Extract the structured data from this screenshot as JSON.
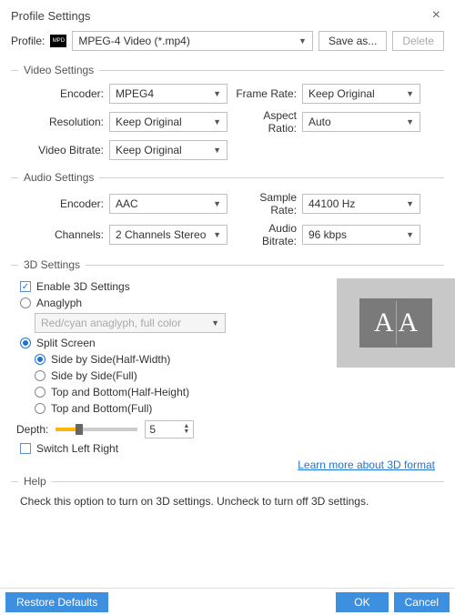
{
  "title": "Profile Settings",
  "close_label": "×",
  "profile_row": {
    "label": "Profile:",
    "icon": "MPD",
    "value": "MPEG-4 Video (*.mp4)",
    "save_as": "Save as...",
    "delete": "Delete"
  },
  "video": {
    "section": "Video Settings",
    "encoder_label": "Encoder:",
    "encoder": "MPEG4",
    "resolution_label": "Resolution:",
    "resolution": "Keep Original",
    "bitrate_label": "Video Bitrate:",
    "bitrate": "Keep Original",
    "frame_rate_label": "Frame Rate:",
    "frame_rate": "Keep Original",
    "aspect_label": "Aspect Ratio:",
    "aspect": "Auto"
  },
  "audio": {
    "section": "Audio Settings",
    "encoder_label": "Encoder:",
    "encoder": "AAC",
    "channels_label": "Channels:",
    "channels": "2 Channels Stereo",
    "sample_rate_label": "Sample Rate:",
    "sample_rate": "44100 Hz",
    "bitrate_label": "Audio Bitrate:",
    "bitrate": "96 kbps"
  },
  "three_d": {
    "section": "3D Settings",
    "enable": "Enable 3D Settings",
    "anaglyph": "Anaglyph",
    "anaglyph_mode": "Red/cyan anaglyph, full color",
    "split": "Split Screen",
    "sbs_half": "Side by Side(Half-Width)",
    "sbs_full": "Side by Side(Full)",
    "tab_half": "Top and Bottom(Half-Height)",
    "tab_full": "Top and Bottom(Full)",
    "depth_label": "Depth:",
    "depth_value": "5",
    "switch_lr": "Switch Left Right",
    "learn_more": "Learn more about 3D format",
    "preview_glyph_l": "A",
    "preview_glyph_r": "A"
  },
  "help": {
    "section": "Help",
    "text": "Check this option to turn on 3D settings. Uncheck to turn off 3D settings."
  },
  "bottom": {
    "restore": "Restore Defaults",
    "ok": "OK",
    "cancel": "Cancel"
  }
}
